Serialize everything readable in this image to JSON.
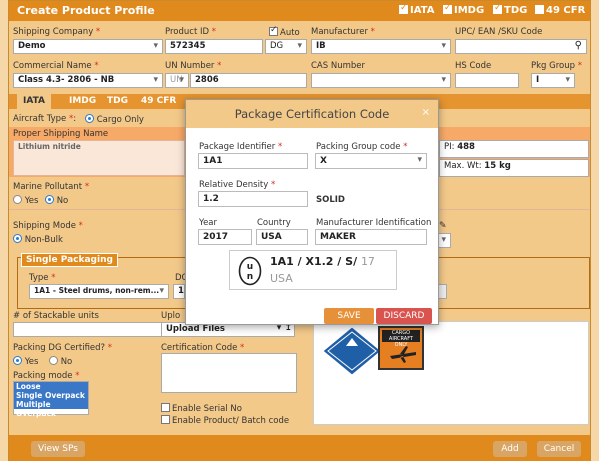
{
  "title": "Create Product Profile",
  "header_flags": [
    {
      "label": "IATA",
      "checked": true
    },
    {
      "label": "IMDG",
      "checked": true
    },
    {
      "label": "TDG",
      "checked": true
    },
    {
      "label": "49 CFR",
      "checked": false
    }
  ],
  "fields": {
    "shipping_company_label": "Shipping Company",
    "shipping_company_value": "Demo",
    "product_id_label": "Product ID",
    "product_id_value": "572345",
    "auto_label": "Auto",
    "dg_value": "DG",
    "manufacturer_label": "Manufacturer",
    "manufacturer_value": "IB",
    "upc_label": "UPC/ EAN /SKU Code",
    "commercial_name_label": "Commercial Name",
    "commercial_name_value": "Class 4.3- 2806 - NB",
    "un_number_label": "UN Number",
    "un_prefix": "UN",
    "un_number_value": "2806",
    "cas_label": "CAS Number",
    "hs_label": "HS Code",
    "pkg_group_label": "Pkg Group",
    "pkg_group_value": "I"
  },
  "tabs": [
    "IATA",
    "IMDG",
    "TDG",
    "49 CFR"
  ],
  "iata": {
    "aircraft_type_label": "Aircraft Type",
    "aircraft_type_value": "Cargo Only",
    "proper_shipping_name_label": "Proper Shipping Name",
    "proper_shipping_name_value": "Lithium nitride",
    "pi_label": "PI:",
    "pi_value": "488",
    "max_wt_label": "Max. Wt:",
    "max_wt_value": "15 kg",
    "marine_pollutant_label": "Marine Pollutant",
    "yes_label": "Yes",
    "no_label": "No",
    "shipping_mode_label": "Shipping Mode",
    "non_bulk_label": "Non-Bulk"
  },
  "single_packaging": {
    "legend": "Single Packaging",
    "type_label": "Type",
    "type_value": "1A1 - Steel drums, non-rem...",
    "dg_partial": "DG",
    "second_partial": "1"
  },
  "lower": {
    "stackable_label": "# of Stackable units",
    "upload_label_partial": "Uplo",
    "upload_value": "Upload Files",
    "packing_certified_label": "Packing DG Certified?",
    "yes_label": "Yes",
    "no_label": "No",
    "certification_code_label": "Certification Code",
    "packing_mode_label": "Packing mode",
    "packing_modes": [
      "Loose",
      "Single Overpack",
      "Multiple Overpack"
    ],
    "enable_serial_label": "Enable Serial No",
    "enable_batch_label": "Enable Product/ Batch code",
    "cargo_aircraft_label": "CARGO AIRCRAFT ONLY"
  },
  "buttons": {
    "view_sps": "View SPs",
    "add": "Add",
    "cancel": "Cancel"
  },
  "modal": {
    "title": "Package Certification Code",
    "close": "×",
    "package_identifier_label": "Package Identifier",
    "package_identifier_value": "1A1",
    "packing_group_label": "Packing Group code",
    "packing_group_value": "X",
    "relative_density_label": "Relative Density",
    "relative_density_value": "1.2",
    "solid_label": "SOLID",
    "year_label": "Year",
    "year_value": "2017",
    "country_label": "Country",
    "country_value": "USA",
    "mfr_id_label": "Manufacturer Identification",
    "mfr_id_value": "MAKER",
    "mark_code": "1A1 / X1.2 / S/",
    "mark_year": "17",
    "mark_country": "USA",
    "save": "SAVE",
    "discard": "DISCARD"
  },
  "colors": {
    "title_bar": "#e08a1e",
    "save_button": "#e6913a",
    "discard_button": "#d9534f",
    "hazmat_blue": "#1f5fa8"
  }
}
